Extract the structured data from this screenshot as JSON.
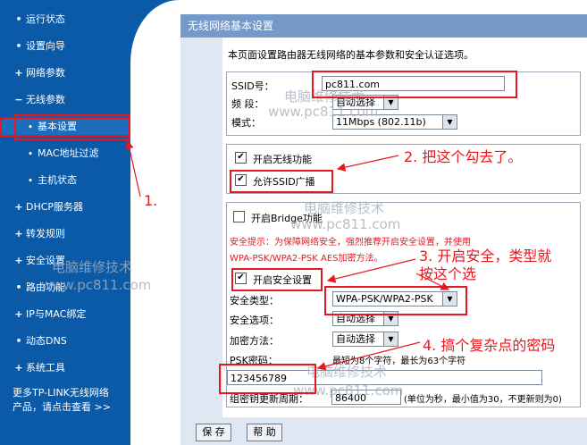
{
  "sidebar": {
    "items": [
      {
        "bullet": "•",
        "label": "运行状态"
      },
      {
        "bullet": "•",
        "label": "设置向导"
      },
      {
        "bullet": "+",
        "label": "网络参数"
      },
      {
        "bullet": "−",
        "label": "无线参数"
      },
      {
        "bullet": "•",
        "label": "基本设置"
      },
      {
        "bullet": "•",
        "label": "MAC地址过滤"
      },
      {
        "bullet": "•",
        "label": "主机状态"
      },
      {
        "bullet": "+",
        "label": "DHCP服务器"
      },
      {
        "bullet": "+",
        "label": "转发规则"
      },
      {
        "bullet": "+",
        "label": "安全设置"
      },
      {
        "bullet": "•",
        "label": "路由功能"
      },
      {
        "bullet": "+",
        "label": "IP与MAC绑定"
      },
      {
        "bullet": "•",
        "label": "动态DNS"
      },
      {
        "bullet": "+",
        "label": "系统工具"
      }
    ],
    "more_line1": "更多TP-LINK无线网络",
    "more_line2": "产品，请点击查看 >>"
  },
  "panel": {
    "title": "无线网络基本设置",
    "description": "本页面设置路由器无线网络的基本参数和安全认证选项。",
    "ssid_label": "SSID号：",
    "ssid_value": "pc811.com",
    "channel_label": "频  段：",
    "channel_value": "自动选择",
    "mode_label": "模式：",
    "mode_value": "11Mbps (802.11b)",
    "enable_wireless_label": "开启无线功能",
    "enable_wireless_checked": true,
    "allow_ssid_broadcast_label": "允许SSID广播",
    "allow_ssid_broadcast_checked": true,
    "enable_bridge_label": "开启Bridge功能",
    "enable_bridge_checked": false,
    "warning_line1": "安全提示：为保障网络安全，强烈推荐开启安全设置，并使用",
    "warning_line2": "WPA-PSK/WPA2-PSK AES加密方法。",
    "enable_security_label": "开启安全设置",
    "enable_security_checked": true,
    "security_type_label": "安全类型：",
    "security_type_value": "WPA-PSK/WPA2-PSK",
    "security_option_label": "安全选项：",
    "security_option_value": "自动选择",
    "encryption_label": "加密方法：",
    "encryption_value": "自动选择",
    "psk_label": "PSK密码：",
    "psk_hint": "最短为8个字符，最长为63个字符",
    "psk_value": "123456789",
    "rekey_label": "组密钥更新周期：",
    "rekey_value": "86400",
    "rekey_hint": "(单位为秒，最小值为30，不更新则为0)"
  },
  "buttons": {
    "save": "保 存",
    "help": "帮 助"
  },
  "annotations": {
    "a1": "1.",
    "a2": "2. 把这个勾去了。",
    "a3_line1": "3. 开启安全，类型就",
    "a3_line2": "按这个选",
    "a4": "4. 搞个复杂点的密码"
  },
  "watermarks": {
    "cn": "电脑维修技术",
    "url": "www.pc811.com"
  },
  "colors": {
    "sidebar": "#0a5aa8",
    "panel_title": "#7599c9",
    "annotation_red": "#e8171f"
  }
}
